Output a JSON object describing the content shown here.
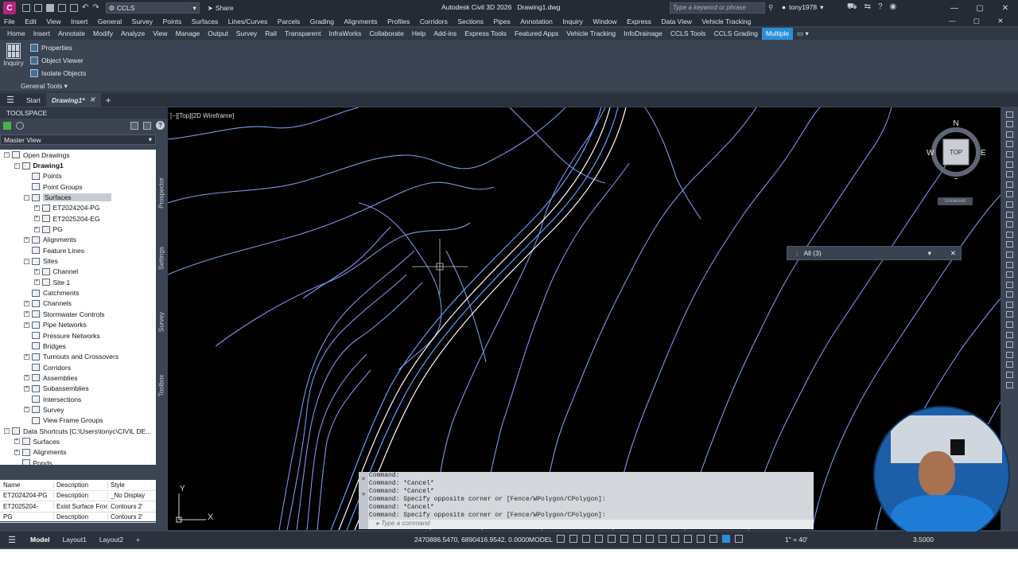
{
  "title": {
    "app": "Autodesk Civil 3D 2026",
    "file": "Drawing1.dwg",
    "workspace": "CCLS",
    "share": "Share",
    "search_placeholder": "Type a keyword or phrase",
    "user": "tony1978"
  },
  "menu": [
    "File",
    "Edit",
    "View",
    "Insert",
    "General",
    "Survey",
    "Points",
    "Surfaces",
    "Lines/Curves",
    "Parcels",
    "Grading",
    "Alignments",
    "Profiles",
    "Corridors",
    "Sections",
    "Pipes",
    "Annotation",
    "Inquiry",
    "Window",
    "Express",
    "Data View",
    "Vehicle Tracking"
  ],
  "ribbon_tabs": [
    "Home",
    "Insert",
    "Annotate",
    "Modify",
    "Analyze",
    "View",
    "Manage",
    "Output",
    "Survey",
    "Rail",
    "Transparent",
    "InfraWorks",
    "Collaborate",
    "Help",
    "Add-ins",
    "Express Tools",
    "Featured Apps",
    "Vehicle Tracking",
    "InfoDrainage",
    "CCLS Tools",
    "CCLS Grading",
    "Multiple"
  ],
  "ribbon_active": "Multiple",
  "ribbon": {
    "inquiry": "Inquiry",
    "properties": "Properties",
    "object_viewer": "Object Viewer",
    "isolate": "Isolate Objects",
    "panel": "General Tools ▾"
  },
  "doc_tabs": {
    "start": "Start",
    "drawing": "Drawing1*"
  },
  "toolspace": {
    "title": "TOOLSPACE",
    "view": "Master View"
  },
  "tree": [
    {
      "label": "Open Drawings",
      "indent": 0,
      "exp": "−"
    },
    {
      "label": "Drawing1",
      "indent": 1,
      "exp": "−",
      "bold": true
    },
    {
      "label": "Points",
      "indent": 2
    },
    {
      "label": "Point Groups",
      "indent": 2
    },
    {
      "label": "Surfaces",
      "indent": 2,
      "exp": "−",
      "sel": true
    },
    {
      "label": "ET2024204-PG",
      "indent": 3,
      "exp": "+"
    },
    {
      "label": "ET2025204-EG",
      "indent": 3,
      "exp": "+"
    },
    {
      "label": "PG",
      "indent": 3,
      "exp": "+"
    },
    {
      "label": "Alignments",
      "indent": 2,
      "exp": "+"
    },
    {
      "label": "Feature Lines",
      "indent": 2
    },
    {
      "label": "Sites",
      "indent": 2,
      "exp": "−"
    },
    {
      "label": "Channel",
      "indent": 3,
      "exp": "+"
    },
    {
      "label": "Site 1",
      "indent": 3,
      "exp": "+"
    },
    {
      "label": "Catchments",
      "indent": 2
    },
    {
      "label": "Channels",
      "indent": 2,
      "exp": "+"
    },
    {
      "label": "Stormwater Controls",
      "indent": 2,
      "exp": "+"
    },
    {
      "label": "Pipe Networks",
      "indent": 2,
      "exp": "+"
    },
    {
      "label": "Pressure Networks",
      "indent": 2
    },
    {
      "label": "Bridges",
      "indent": 2
    },
    {
      "label": "Turnouts and Crossovers",
      "indent": 2,
      "exp": "+"
    },
    {
      "label": "Corridors",
      "indent": 2
    },
    {
      "label": "Assemblies",
      "indent": 2,
      "exp": "+"
    },
    {
      "label": "Subassemblies",
      "indent": 2,
      "exp": "+"
    },
    {
      "label": "Intersections",
      "indent": 2
    },
    {
      "label": "Survey",
      "indent": 2,
      "exp": "+"
    },
    {
      "label": "View Frame Groups",
      "indent": 2
    },
    {
      "label": "Data Shortcuts [C:\\Users\\tonyc\\CIVIL DE...",
      "indent": 0,
      "exp": "−"
    },
    {
      "label": "Surfaces",
      "indent": 1,
      "exp": "+"
    },
    {
      "label": "Alignments",
      "indent": 1,
      "exp": "+"
    },
    {
      "label": "Ponds",
      "indent": 1
    }
  ],
  "side_tabs": [
    "Prospector",
    "Settings",
    "Survey",
    "Toolbox"
  ],
  "grid": {
    "headers": [
      "Name",
      "Description",
      "Style"
    ],
    "rows": [
      [
        "ET2024204-PG",
        "Description",
        "_No Display"
      ],
      [
        "ET2025204-",
        "Exist Surface Fron",
        "Contours 2'"
      ],
      [
        "PG",
        "Description",
        "Contours 2'"
      ]
    ]
  },
  "viewport": {
    "label": "[−][Top][2D Wireframe]",
    "compass": {
      "n": "N",
      "s": "S",
      "e": "E",
      "w": "W",
      "top": "TOP",
      "ucs": "Unnamed"
    },
    "filter": "All (3)",
    "ucs_x": "X",
    "ucs_y": "Y"
  },
  "command": {
    "lines": [
      "Command:",
      "Command: *Cancel*",
      "Command: *Cancel*",
      "Command: Specify opposite corner or [Fence/WPolygon/CPolygon]:",
      "Command: *Cancel*",
      "Command: Specify opposite corner or [Fence/WPolygon/CPolygon]:"
    ],
    "placeholder": "Type a command"
  },
  "status": {
    "model": "Model",
    "layout1": "Layout1",
    "layout2": "Layout2",
    "coords": "2470886.5470, 6890416.9542, 0.0000",
    "mode": "MODEL",
    "scale": "1\" = 40'",
    "lineweight": "3.5000"
  },
  "colors": {
    "accent": "#2a8fd8",
    "contour": "#7d97e8",
    "corridor": "#5da0ff"
  }
}
